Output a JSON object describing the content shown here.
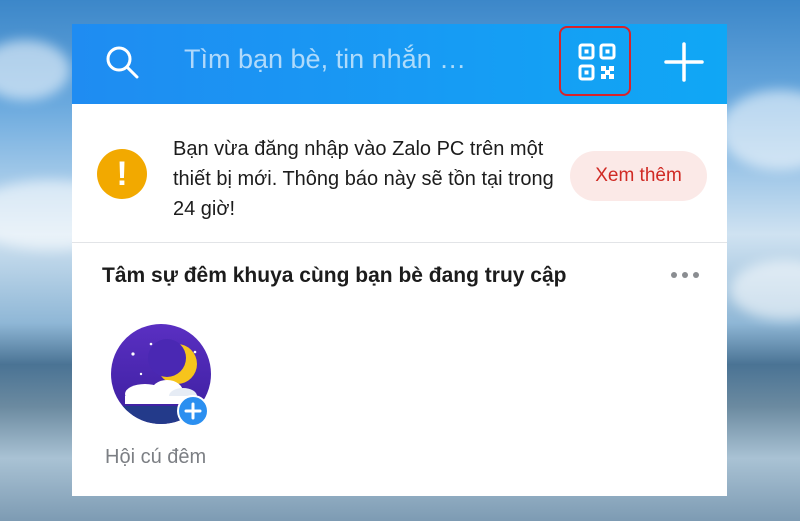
{
  "desktop": {
    "wallpaper": "sky-and-sea"
  },
  "header": {
    "search_placeholder": "Tìm bạn bè, tin nhắn …",
    "search_icon": "search-icon",
    "qr_icon": "qr-code-icon",
    "add_icon": "plus-icon",
    "colors": {
      "gradient_start": "#1f8cf2",
      "gradient_end": "#10a7f5",
      "highlight": "#d8232a"
    }
  },
  "notice": {
    "icon": "exclamation-icon",
    "text": "Bạn vừa đăng nhập vào Zalo PC trên một thiết bị mới. Thông báo này sẽ tồn tại trong 24 giờ!",
    "button_label": "Xem thêm"
  },
  "section": {
    "title": "Tâm sự đêm khuya cùng bạn bè đang truy cập",
    "menu_icon": "more-horizontal-icon",
    "items": [
      {
        "label": "Hội cú đêm",
        "icon": "moon-night-icon"
      }
    ]
  }
}
